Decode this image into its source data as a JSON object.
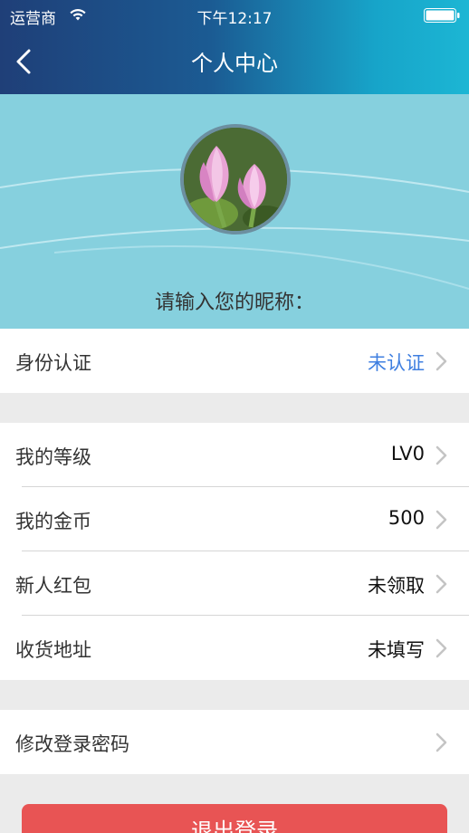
{
  "status_bar": {
    "carrier": "运营商",
    "time": "下午12:17"
  },
  "nav": {
    "title": "个人中心"
  },
  "profile": {
    "nickname_prompt": "请输入您的昵称："
  },
  "rows": {
    "identity": {
      "label": "身份认证",
      "value": "未认证"
    },
    "level": {
      "label": "我的等级",
      "value": "LV0"
    },
    "coins": {
      "label": "我的金币",
      "value": "500"
    },
    "red_packet": {
      "label": "新人红包",
      "value": "未领取"
    },
    "address": {
      "label": "收货地址",
      "value": "未填写"
    },
    "password": {
      "label": "修改登录密码"
    }
  },
  "logout": {
    "label": "退出登录"
  },
  "colors": {
    "accent_blue": "#3f7fe0",
    "logout_red": "#e85454",
    "profile_bg": "#86d0de"
  },
  "icons": [
    "wifi-icon",
    "battery-icon",
    "back-icon",
    "chevron-right-icon"
  ]
}
